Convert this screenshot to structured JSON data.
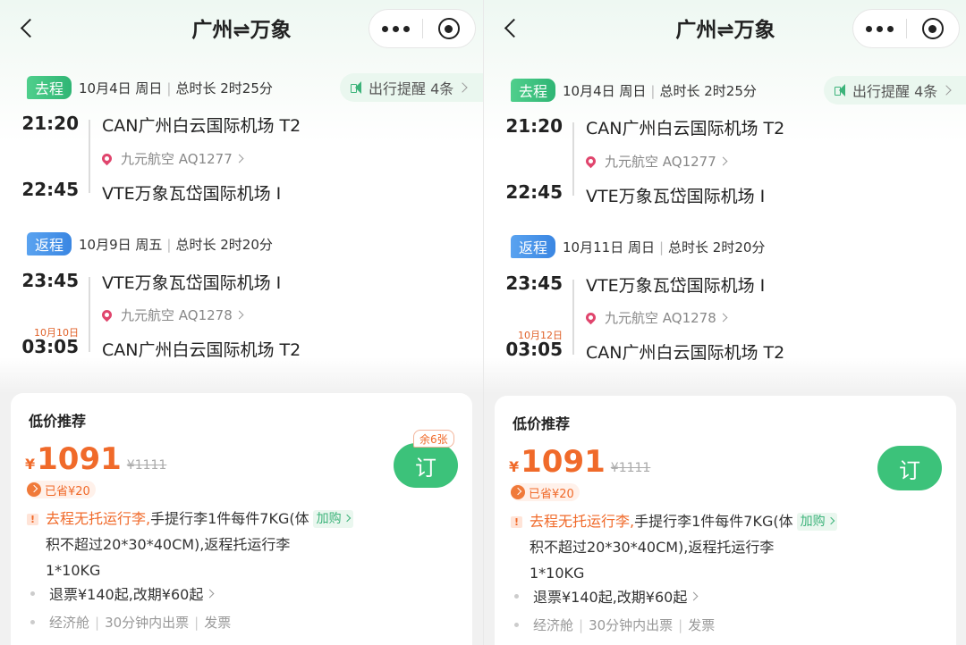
{
  "panels": [
    {
      "title": "广州⇌万象",
      "outbound": {
        "tag": "去程",
        "date": "10月4日 周日",
        "duration": "总时长 2时25分",
        "dep_time": "21:20",
        "dep_airport": "CAN广州白云国际机场 T2",
        "airline": "九元航空 AQ1277",
        "arr_time": "22:45",
        "arr_airport": "VTE万象瓦岱国际机场 I"
      },
      "reminder": "出行提醒 4条",
      "return": {
        "tag": "返程",
        "date": "10月9日 周五",
        "duration": "总时长 2时20分",
        "dep_time": "23:45",
        "dep_airport": "VTE万象瓦岱国际机场 I",
        "airline": "九元航空 AQ1278",
        "arr_date_small": "10月10日",
        "arr_time": "03:05",
        "arr_airport": "CAN广州白云国际机场 T2"
      },
      "card": {
        "title": "低价推荐",
        "currency": "¥",
        "price": "1091",
        "original_price": "¥1111",
        "saved": "已省¥20",
        "book_label": "订",
        "remaining": "余6张",
        "baggage_warn": "去程无托运行李,",
        "baggage_text_1": "手提行李1件每件7KG(体",
        "addon_label": "加购",
        "baggage_text_2": "积不超过20*30*40CM),返程托运行李",
        "baggage_text_3": "1*10KG",
        "refund": "退票¥140起,改期¥60起",
        "cabin": "经济舱",
        "ticketing": "30分钟内出票",
        "invoice": "发票"
      }
    },
    {
      "title": "广州⇌万象",
      "outbound": {
        "tag": "去程",
        "date": "10月4日 周日",
        "duration": "总时长 2时25分",
        "dep_time": "21:20",
        "dep_airport": "CAN广州白云国际机场 T2",
        "airline": "九元航空 AQ1277",
        "arr_time": "22:45",
        "arr_airport": "VTE万象瓦岱国际机场 I"
      },
      "reminder": "出行提醒 4条",
      "return": {
        "tag": "返程",
        "date": "10月11日 周日",
        "duration": "总时长 2时20分",
        "dep_time": "23:45",
        "dep_airport": "VTE万象瓦岱国际机场 I",
        "airline": "九元航空 AQ1278",
        "arr_date_small": "10月12日",
        "arr_time": "03:05",
        "arr_airport": "CAN广州白云国际机场 T2"
      },
      "card": {
        "title": "低价推荐",
        "currency": "¥",
        "price": "1091",
        "original_price": "¥1111",
        "saved": "已省¥20",
        "book_label": "订",
        "remaining": "",
        "baggage_warn": "去程无托运行李,",
        "baggage_text_1": "手提行李1件每件7KG(体",
        "addon_label": "加购",
        "baggage_text_2": "积不超过20*30*40CM),返程托运行李",
        "baggage_text_3": "1*10KG",
        "refund": "退票¥140起,改期¥60起",
        "cabin": "经济舱",
        "ticketing": "30分钟内出票",
        "invoice": "发票"
      }
    }
  ]
}
